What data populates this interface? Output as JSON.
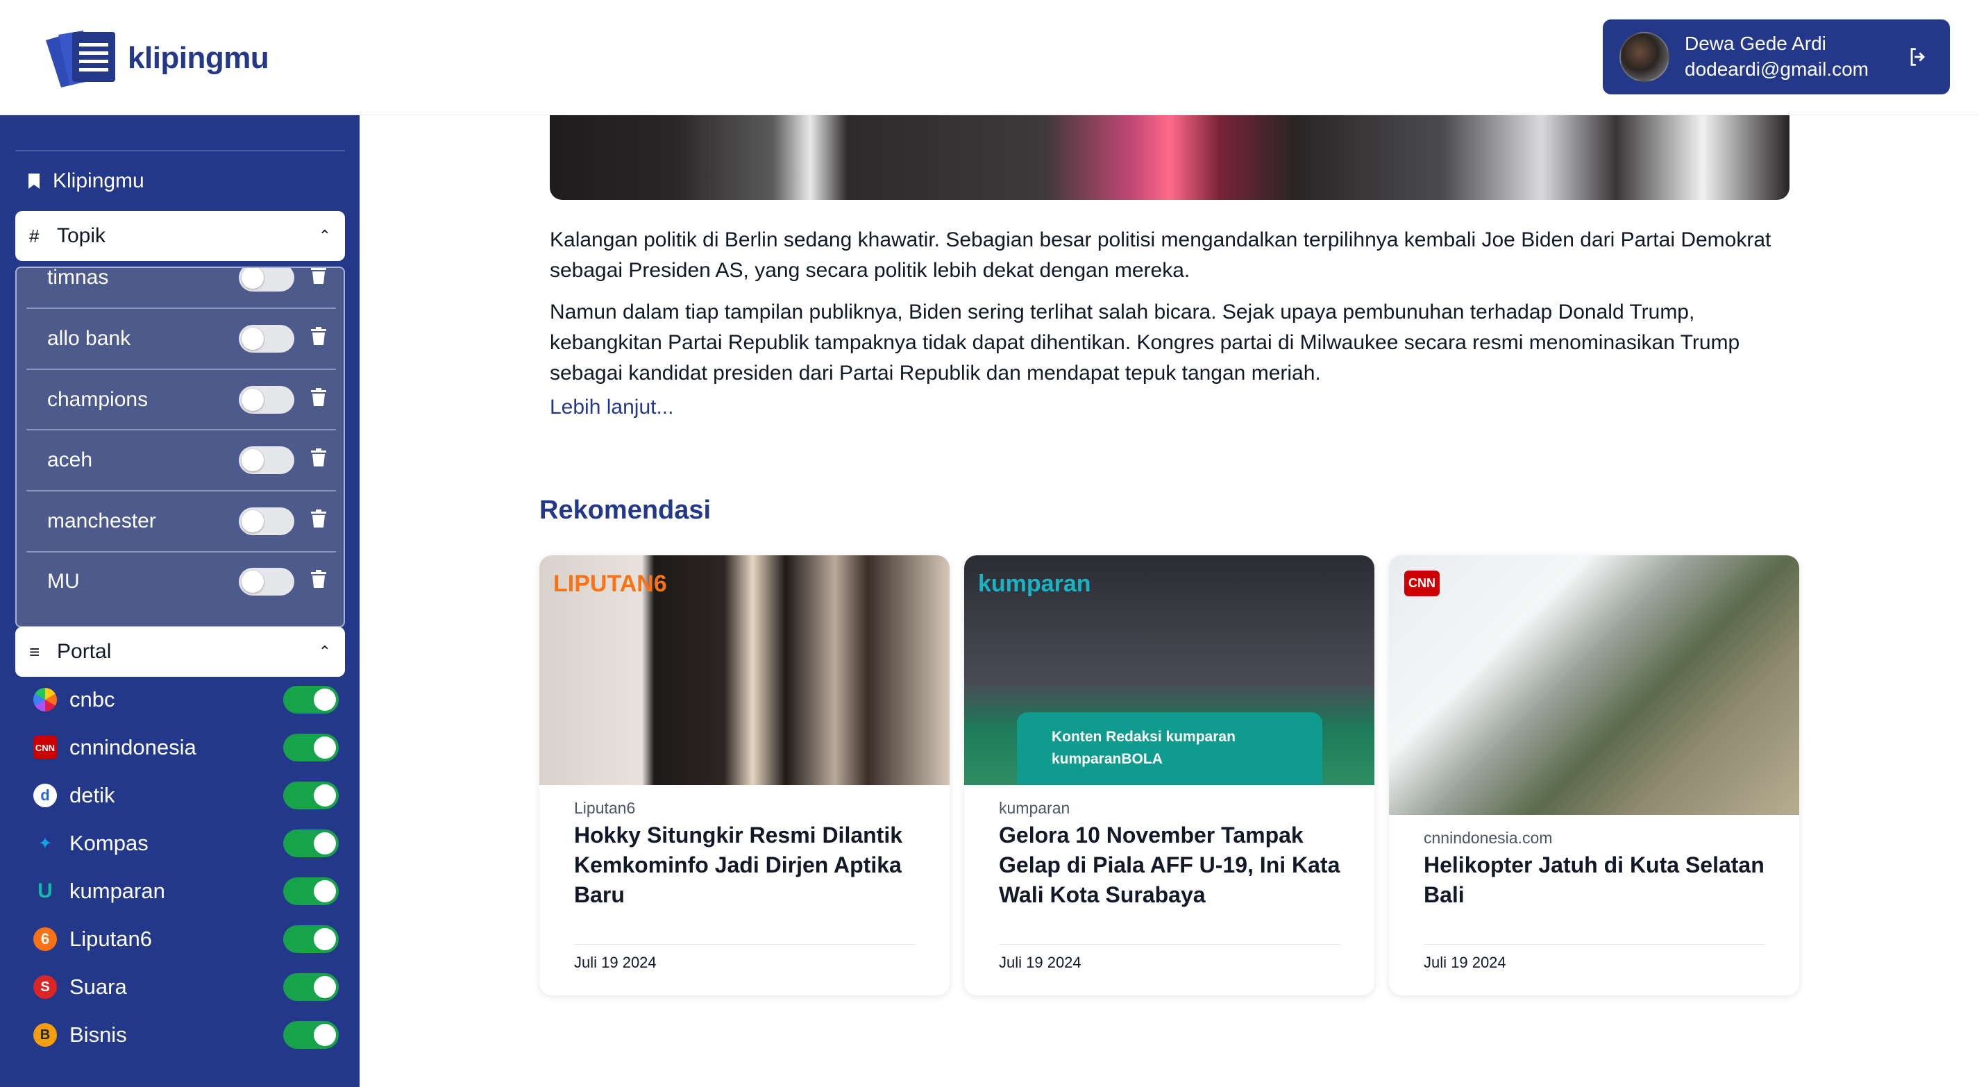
{
  "app": {
    "brand": "klipingmu"
  },
  "user": {
    "name": "Dewa Gede Ardi",
    "email": "dodeardi@gmail.com"
  },
  "sidebar": {
    "klipingmu_label": "Klipingmu",
    "topik_label": "Topik",
    "portal_label": "Portal",
    "topics": [
      {
        "label": "timnas",
        "enabled": false
      },
      {
        "label": "allo bank",
        "enabled": false
      },
      {
        "label": "champions",
        "enabled": false
      },
      {
        "label": "aceh",
        "enabled": false
      },
      {
        "label": "manchester",
        "enabled": false
      },
      {
        "label": "MU",
        "enabled": false
      }
    ],
    "portals": [
      {
        "label": "cnbc",
        "enabled": true,
        "icon": "cnbc-peacock-icon",
        "color": "#e11d48"
      },
      {
        "label": "cnnindonesia",
        "enabled": true,
        "icon": "cnn-icon",
        "color": "#cc0000"
      },
      {
        "label": "detik",
        "enabled": true,
        "icon": "detik-icon",
        "color": "#2563eb"
      },
      {
        "label": "Kompas",
        "enabled": true,
        "icon": "kompas-icon",
        "color": "#0ea5e9"
      },
      {
        "label": "kumparan",
        "enabled": true,
        "icon": "kumparan-icon",
        "color": "#14b8a6"
      },
      {
        "label": "Liputan6",
        "enabled": true,
        "icon": "liputan6-icon",
        "color": "#f97316"
      },
      {
        "label": "Suara",
        "enabled": true,
        "icon": "suara-icon",
        "color": "#dc2626"
      },
      {
        "label": "Bisnis",
        "enabled": true,
        "icon": "bisnis-icon",
        "color": "#f59e0b"
      }
    ]
  },
  "article": {
    "paragraph1": "Kalangan politik di Berlin sedang khawatir. Sebagian besar politisi mengandalkan terpilihnya kembali Joe Biden dari Partai Demokrat sebagai Presiden AS, yang secara politik lebih dekat dengan mereka.",
    "paragraph2": "Namun dalam tiap tampilan publiknya, Biden sering terlihat salah bicara. Sejak upaya pembunuhan terhadap Donald Trump, kebangkitan Partai Republik tampaknya tidak dapat dihentikan. Kongres partai di Milwaukee secara resmi menominasikan Trump sebagai kandidat presiden dari Partai Republik dan mendapat tepuk tangan meriah.",
    "more_link": "Lebih lanjut..."
  },
  "recommendations": {
    "title": "Rekomendasi",
    "cards": [
      {
        "badge": "LIPUTAN6",
        "source": "Liputan6",
        "title": "Hokky Situngkir Resmi Dilantik Kemkominfo Jadi Dirjen Aptika Baru",
        "date": "Juli 19 2024"
      },
      {
        "badge": "kumparan",
        "source": "kumparan",
        "title": "Gelora 10 November Tampak Gelap di Piala AFF U-19, Ini Kata Wali Kota Surabaya",
        "date": "Juli 19 2024",
        "overlay_line1": "Konten Redaksi kumparan",
        "overlay_line2": "kumparanBOLA"
      },
      {
        "badge": "CNN",
        "source": "cnnindonesia.com",
        "title": "Helikopter Jatuh di Kuta Selatan Bali",
        "date": "Juli 19 2024"
      }
    ]
  },
  "colors": {
    "primary": "#24388a",
    "toggle_on": "#16a34a",
    "toggle_off": "#e5e7eb"
  }
}
